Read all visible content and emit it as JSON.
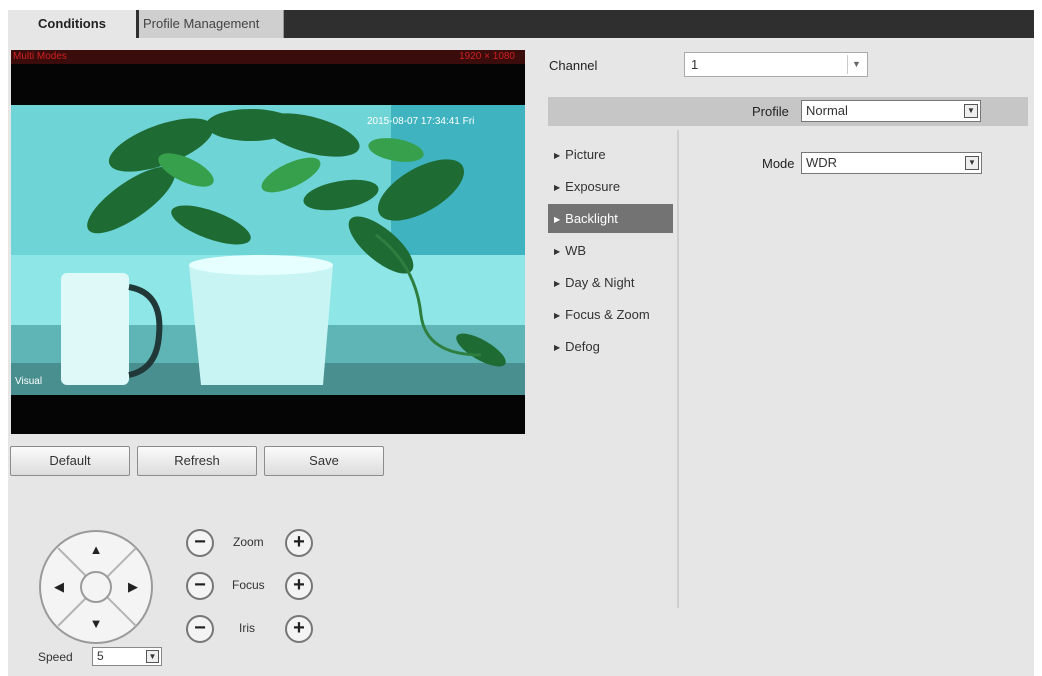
{
  "tabs": [
    {
      "label": "Conditions",
      "active": true
    },
    {
      "label": "Profile Management",
      "active": false
    }
  ],
  "preview": {
    "overlay_left": "Multi Modes",
    "overlay_right": "1920 × 1080",
    "timestamp": "2015-08-07 17:34:41 Fri",
    "channel_label": "Visual"
  },
  "actions": {
    "default_label": "Default",
    "refresh_label": "Refresh",
    "save_label": "Save"
  },
  "ptz": {
    "zoom_label": "Zoom",
    "focus_label": "Focus",
    "iris_label": "Iris",
    "minus_symbol": "−",
    "plus_symbol": "+",
    "speed_label": "Speed",
    "speed_value": "5"
  },
  "channel": {
    "label": "Channel",
    "value": "1"
  },
  "profile": {
    "label": "Profile",
    "value": "Normal"
  },
  "menu": {
    "items": [
      {
        "label": "Picture",
        "active": false
      },
      {
        "label": "Exposure",
        "active": false
      },
      {
        "label": "Backlight",
        "active": true
      },
      {
        "label": "WB",
        "active": false
      },
      {
        "label": "Day & Night",
        "active": false
      },
      {
        "label": "Focus & Zoom",
        "active": false
      },
      {
        "label": "Defog",
        "active": false
      }
    ]
  },
  "mode": {
    "label": "Mode",
    "value": "WDR"
  },
  "colors": {
    "active_menu": "#737373",
    "overlay_text": "#d12020",
    "tab_bar": "#2f2f2f"
  }
}
